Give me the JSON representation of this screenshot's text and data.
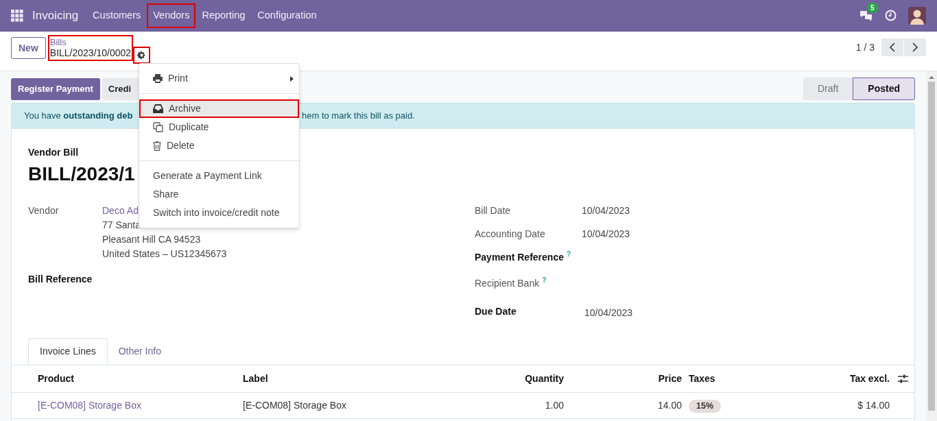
{
  "navbar": {
    "app_name": "Invoicing",
    "menu": [
      {
        "label": "Customers",
        "highlighted": false
      },
      {
        "label": "Vendors",
        "highlighted": true
      },
      {
        "label": "Reporting",
        "highlighted": false
      },
      {
        "label": "Configuration",
        "highlighted": false
      }
    ],
    "messages_badge": "5"
  },
  "control_panel": {
    "new_button": "New",
    "breadcrumb": {
      "parent": "Bills",
      "current": "BILL/2023/10/0002",
      "highlighted": true
    },
    "gear_highlighted": true,
    "pager": "1 / 3"
  },
  "action_menu": {
    "sections": [
      [
        {
          "label": "Print",
          "submenu": true,
          "highlighted": false
        }
      ],
      [
        {
          "label": "Archive",
          "submenu": false,
          "highlighted": true
        },
        {
          "label": "Duplicate",
          "submenu": false,
          "highlighted": false
        },
        {
          "label": "Delete",
          "submenu": false,
          "highlighted": false
        }
      ],
      [
        {
          "label": "Generate a Payment Link",
          "submenu": false,
          "highlighted": false
        },
        {
          "label": "Share",
          "submenu": false,
          "highlighted": false
        },
        {
          "label": "Switch into invoice/credit note",
          "submenu": false,
          "highlighted": false
        }
      ]
    ]
  },
  "buttons": [
    {
      "label": "Register Payment",
      "kind": "primary"
    },
    {
      "label": "Credi",
      "kind": "secondary"
    }
  ],
  "status_bar": [
    {
      "label": "Draft",
      "selected": false
    },
    {
      "label": "Posted",
      "selected": true
    }
  ],
  "alert": {
    "text_before": "You have **outstanding deb**",
    "text_after": "hem to mark this bill as paid."
  },
  "sheet": {
    "subtitle": "Vendor Bill",
    "title": "BILL/2023/1",
    "vendor": {
      "label": "Vendor",
      "name": "Deco Ad",
      "address_lines": [
        "77 Santa",
        "Pleasant Hill CA 94523",
        "United States – US12345673"
      ]
    },
    "bill_reference": {
      "label": "Bill Reference"
    },
    "right_fields": [
      {
        "label": "Bill Date",
        "value": "10/04/2023",
        "required": false
      },
      {
        "label": "Accounting Date",
        "value": "10/04/2023",
        "required": false
      },
      {
        "label": "Payment Reference",
        "help": "?",
        "required": true
      },
      {
        "label": "Recipient Bank",
        "help": "?",
        "required": false
      },
      {
        "label": "Due Date",
        "value": "10/04/2023",
        "required": true
      }
    ]
  },
  "tabs": [
    {
      "label": "Invoice Lines",
      "selected": true
    },
    {
      "label": "Other Info",
      "selected": false
    }
  ],
  "table": {
    "columns": [
      "Product",
      "Label",
      "Quantity",
      "Price",
      "Taxes",
      "Tax excl."
    ],
    "rows": [
      {
        "product": "[E-COM08] Storage Box",
        "label": "[E-COM08] Storage Box",
        "quantity": "1.00",
        "price": "14.00",
        "taxes": "15%",
        "tax_excl": "$ 14.00"
      }
    ]
  }
}
